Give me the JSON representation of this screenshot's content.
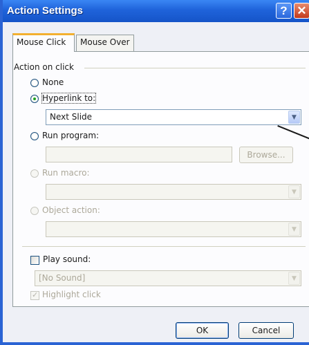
{
  "window": {
    "title": "Action Settings"
  },
  "titlebar": {
    "help_glyph": "?",
    "close_glyph": "✕"
  },
  "tabs": [
    {
      "label": "Mouse Click",
      "active": true
    },
    {
      "label": "Mouse Over",
      "active": false
    }
  ],
  "group": {
    "label": "Action on click"
  },
  "options": {
    "none": {
      "label": "None",
      "checked": false,
      "enabled": true
    },
    "hyperlink": {
      "label": "Hyperlink to:",
      "checked": true,
      "enabled": true
    },
    "run_program": {
      "label": "Run program:",
      "checked": false,
      "enabled": true
    },
    "run_macro": {
      "label": "Run macro:",
      "checked": false,
      "enabled": false
    },
    "object_action": {
      "label": "Object action:",
      "checked": false,
      "enabled": false
    }
  },
  "hyperlink_select": {
    "value": "Next Slide"
  },
  "run_program_input": {
    "value": ""
  },
  "browse_button": {
    "label": "Browse..."
  },
  "run_macro_select": {
    "value": ""
  },
  "object_action_select": {
    "value": ""
  },
  "play_sound": {
    "label": "Play sound:",
    "checked": false
  },
  "sound_select": {
    "value": "[No Sound]"
  },
  "highlight_click": {
    "label": "Highlight click",
    "checked": true,
    "enabled": false
  },
  "buttons": {
    "ok": "OK",
    "cancel": "Cancel"
  },
  "icons": {
    "dropdown": "chevron-down-icon",
    "check": "checkmark-icon"
  },
  "colors": {
    "titlebar": "#1f63da",
    "close_button": "#c2391b",
    "tab_highlight": "#f3b02f",
    "selected_radio": "#21a121"
  }
}
